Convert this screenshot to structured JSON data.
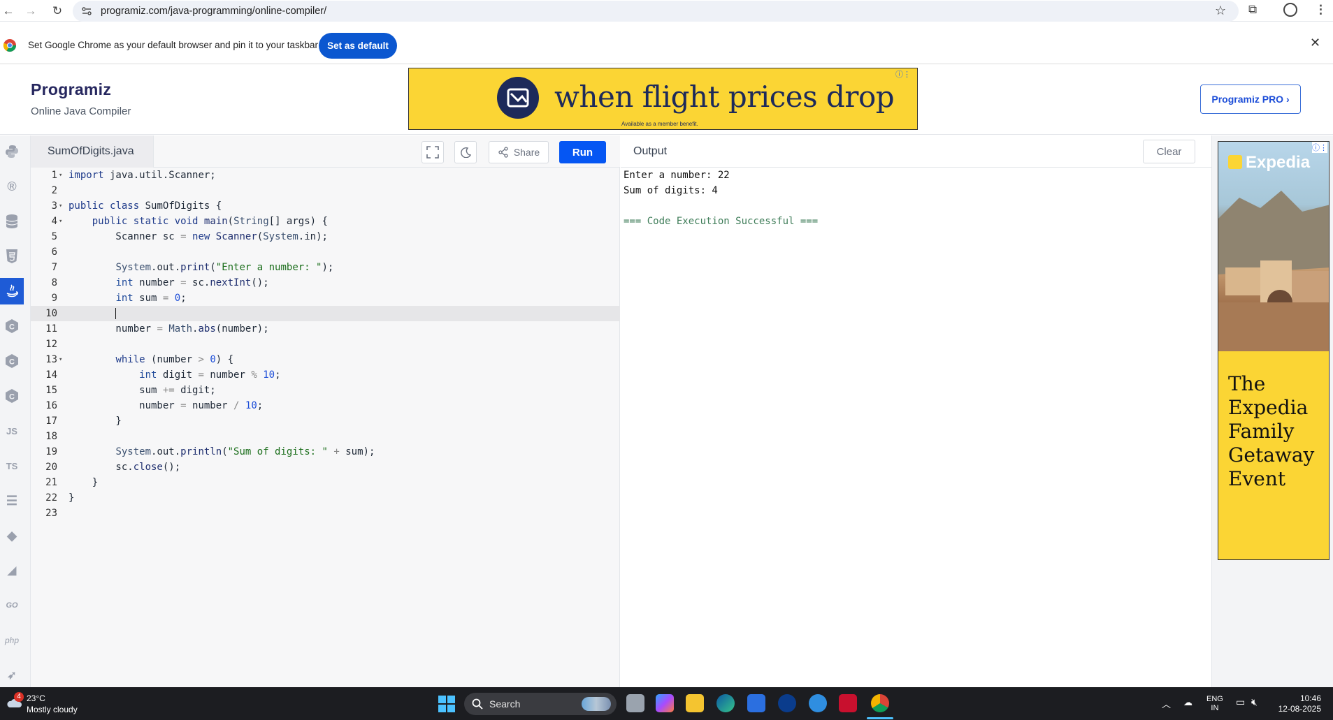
{
  "browser": {
    "url": "programiz.com/java-programming/online-compiler/",
    "infobar_text": "Set Google Chrome as your default browser and pin it to your taskbar",
    "set_default_label": "Set as default"
  },
  "header": {
    "logo": "Programiz",
    "subtitle": "Online Java Compiler",
    "ad_text": "when flight prices drop",
    "ad_subtext": "Available as a member benefit.",
    "pro_button": "Programiz PRO ›"
  },
  "sidebar": {
    "items": [
      {
        "icon": "python-icon",
        "label": ""
      },
      {
        "icon": "r-icon",
        "label": ""
      },
      {
        "icon": "sql-icon",
        "label": ""
      },
      {
        "icon": "html-icon",
        "label": ""
      },
      {
        "icon": "java-icon",
        "label": "",
        "active": true
      },
      {
        "icon": "c-icon",
        "label": ""
      },
      {
        "icon": "cpp-icon",
        "label": ""
      },
      {
        "icon": "csharp-icon",
        "label": ""
      },
      {
        "icon": "javascript-icon",
        "label": "JS"
      },
      {
        "icon": "typescript-icon",
        "label": "TS"
      },
      {
        "icon": "stack-icon",
        "label": ""
      },
      {
        "icon": "ruby-icon",
        "label": ""
      },
      {
        "icon": "kotlin-icon",
        "label": ""
      },
      {
        "icon": "go-icon",
        "label": "GO"
      },
      {
        "icon": "php-icon",
        "label": "php"
      },
      {
        "icon": "swift-icon",
        "label": ""
      }
    ]
  },
  "editor": {
    "filename": "SumOfDigits.java",
    "share_label": "Share",
    "run_label": "Run",
    "current_line": 10
  },
  "output": {
    "title": "Output",
    "clear_label": "Clear",
    "lines": [
      "Enter a number: 22",
      "Sum of digits: 4",
      "",
      "=== Code Execution Successful ==="
    ]
  },
  "right_ad": {
    "brand": "Expedia",
    "text": "The Expedia Family Getaway Event"
  },
  "taskbar": {
    "temperature": "23°C",
    "weather": "Mostly cloudy",
    "weather_badge": "4",
    "search_label": "Search",
    "lang_top": "ENG",
    "lang_bottom": "IN",
    "time": "10:46",
    "date": "12-08-2025"
  },
  "colors": {
    "run_button": "#0556f3",
    "ad_yellow": "#fbd534",
    "set_default": "#0b57d0"
  }
}
